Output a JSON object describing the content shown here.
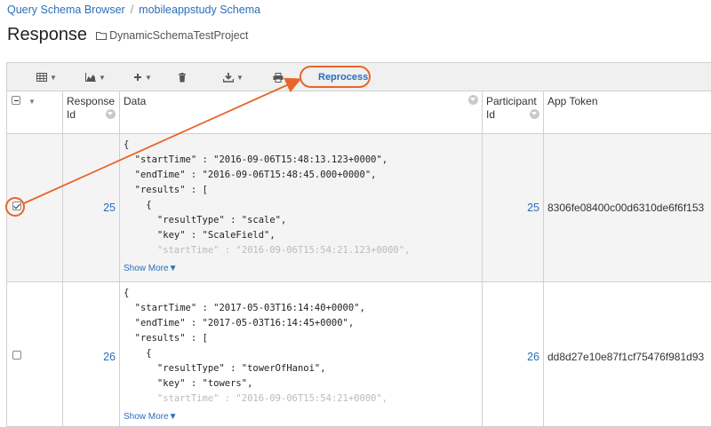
{
  "breadcrumb": {
    "items": [
      "Query Schema Browser",
      "mobileappstudy Schema"
    ],
    "separator": "/"
  },
  "page": {
    "title": "Response",
    "folder": "DynamicSchemaTestProject"
  },
  "toolbar": {
    "reprocess_label": "Reprocess"
  },
  "columns": {
    "response_id": "Response Id",
    "data": "Data",
    "participant_id": "Participant Id",
    "app_token": "App Token"
  },
  "rows": [
    {
      "checked": true,
      "response_id": "25",
      "participant_id": "25",
      "app_token": "8306fe08400c00d6310de6f6f153",
      "json_lines": [
        "{",
        "  \"startTime\" : \"2016-09-06T15:48:13.123+0000\",",
        "  \"endTime\" : \"2016-09-06T15:48:45.000+0000\",",
        "  \"results\" : [",
        "    {",
        "      \"resultType\" : \"scale\",",
        "      \"key\" : \"ScaleField\",",
        "      \"startTime\" : \"2016-09-06T15:54:21.123+0000\","
      ],
      "show_more": "Show More▼"
    },
    {
      "checked": false,
      "response_id": "26",
      "participant_id": "26",
      "app_token": "dd8d27e10e87f1cf75476f981d93",
      "json_lines": [
        "{",
        "  \"startTime\" : \"2017-05-03T16:14:40+0000\",",
        "  \"endTime\" : \"2017-05-03T16:14:45+0000\",",
        "  \"results\" : [",
        "    {",
        "      \"resultType\" : \"towerOfHanoi\",",
        "      \"key\" : \"towers\",",
        "      \"startTime\" : \"2016-09-06T15:54:21+0000\","
      ],
      "show_more": "Show More▼"
    }
  ],
  "colors": {
    "link": "#2a6ebb",
    "annotation": "#e8652a",
    "grid_border": "#d0d0d0"
  }
}
